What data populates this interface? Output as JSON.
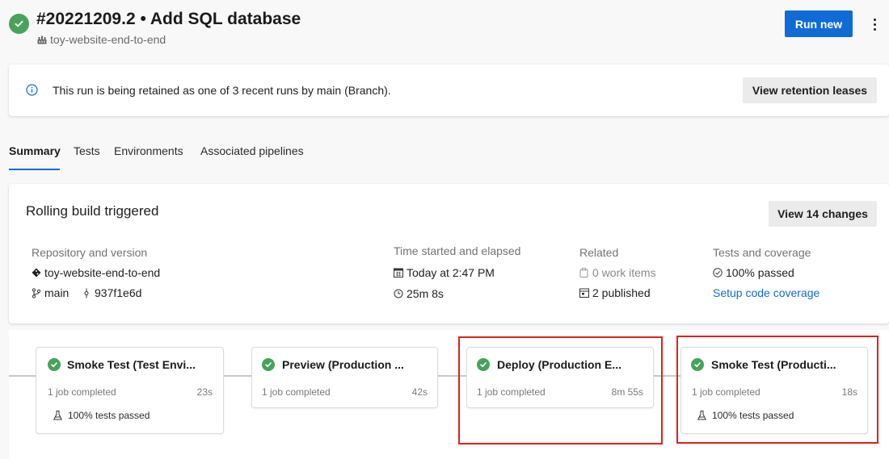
{
  "header": {
    "run_title": "#20221209.2 • Add SQL database",
    "pipeline_name": "toy-website-end-to-end",
    "run_new_label": "Run new",
    "status": "succeeded",
    "status_color": "#47a35a",
    "more_icon": "more-vertical-icon"
  },
  "banner": {
    "icon": "info-icon",
    "text": "This run is being retained as one of 3 recent runs by main (Branch).",
    "button_label": "View retention leases"
  },
  "tabs": [
    {
      "label": "Summary",
      "active": true
    },
    {
      "label": "Tests",
      "active": false
    },
    {
      "label": "Environments",
      "active": false
    },
    {
      "label": "Associated pipelines",
      "active": false
    }
  ],
  "summary": {
    "title": "Rolling build triggered",
    "changes_button": "View 14 changes",
    "repository": {
      "label": "Repository and version",
      "repo_name": "toy-website-end-to-end",
      "branch": "main",
      "commit": "937f1e6d"
    },
    "time": {
      "label": "Time started and elapsed",
      "started": "Today at 2:47 PM",
      "elapsed": "25m 8s"
    },
    "related": {
      "label": "Related",
      "work_items": "0 work items",
      "published": "2 published"
    },
    "tests": {
      "label": "Tests and coverage",
      "passed": "100% passed",
      "coverage_link": "Setup code coverage"
    }
  },
  "stages": [
    {
      "name": "Smoke Test (Test Envi...",
      "jobs": "1 job completed",
      "duration": "23s",
      "tests": "100% tests passed",
      "highlighted": false
    },
    {
      "name": "Preview (Production ...",
      "jobs": "1 job completed",
      "duration": "42s",
      "tests": null,
      "highlighted": false
    },
    {
      "name": "Deploy (Production E...",
      "jobs": "1 job completed",
      "duration": "8m 55s",
      "tests": null,
      "highlighted": true
    },
    {
      "name": "Smoke Test (Producti...",
      "jobs": "1 job completed",
      "duration": "18s",
      "tests": "100% tests passed",
      "highlighted": true
    }
  ],
  "colors": {
    "accent": "#0f6cd5",
    "success": "#47a35a",
    "highlight": "#e02020"
  }
}
